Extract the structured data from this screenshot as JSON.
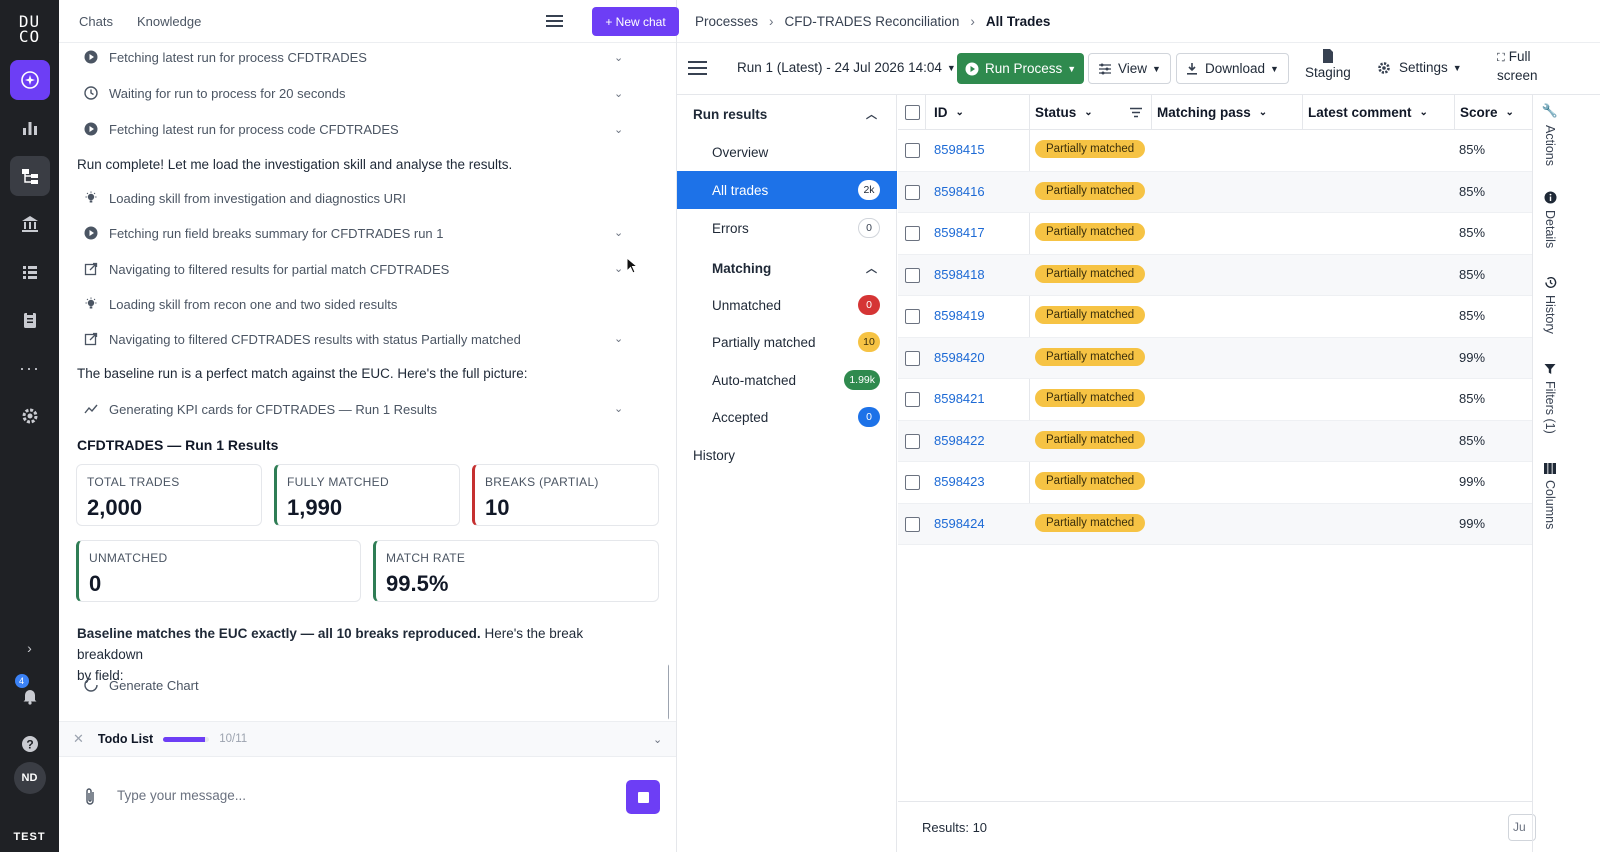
{
  "rail": {
    "logo_line1": "DU",
    "logo_line2": "CO",
    "notification_count": "4",
    "avatar_initials": "ND",
    "env_badge": "TEST"
  },
  "chat": {
    "tabs": [
      "Chats",
      "Knowledge"
    ],
    "new_chat_label": "+ New chat",
    "steps": [
      {
        "icon": "play-icon",
        "text": "Fetching latest run for process CFDTRADES",
        "expandable": true
      },
      {
        "icon": "clock-icon",
        "text": "Waiting for run to process for 20 seconds",
        "expandable": true
      },
      {
        "icon": "play-icon",
        "text": "Fetching latest run for process code CFDTRADES",
        "expandable": true
      }
    ],
    "msg1": "Run complete! Let me load the investigation skill and analyse the results.",
    "steps2": [
      {
        "icon": "bulb-icon",
        "text": "Loading skill from investigation and diagnostics URI",
        "expandable": false
      },
      {
        "icon": "play-icon",
        "text": "Fetching run field breaks summary for CFDTRADES run 1",
        "expandable": true
      },
      {
        "icon": "external-link-icon",
        "text": "Navigating to filtered results for partial match CFDTRADES",
        "expandable": true
      },
      {
        "icon": "bulb-icon",
        "text": "Loading skill from recon one and two sided results",
        "expandable": false
      },
      {
        "icon": "external-link-icon",
        "text": "Navigating to filtered CFDTRADES results with status Partially matched",
        "expandable": true
      }
    ],
    "msg2": "The baseline run is a perfect match against the EUC. Here's the full picture:",
    "kpi_step": "Generating KPI cards for CFDTRADES — Run 1 Results",
    "results_title": "CFDTRADES — Run 1 Results",
    "kpis": [
      {
        "label": "TOTAL TRADES",
        "value": "2,000"
      },
      {
        "label": "FULLY MATCHED",
        "value": "1,990"
      },
      {
        "label": "BREAKS (PARTIAL)",
        "value": "10"
      },
      {
        "label": "UNMATCHED",
        "value": "0"
      },
      {
        "label": "MATCH RATE",
        "value": "99.5%"
      }
    ],
    "summary_bold": "Baseline matches the EUC exactly — all 10 breaks reproduced.",
    "summary_rest": " Here's the break breakdown",
    "summary_line2": "by field:",
    "generate_chart": "Generate Chart",
    "todo_label": "Todo List",
    "todo_count": "10/11",
    "todo_progress": 0.909,
    "input_placeholder": "Type your message..."
  },
  "breadcrumb": [
    "Processes",
    "CFD-TRADES Reconciliation",
    "All Trades"
  ],
  "toolbar": {
    "run_selector": "Run 1 (Latest) - 24 Jul 2026 14:04",
    "run_process": "Run Process",
    "view": "View",
    "download": "Download",
    "staging": "Staging",
    "settings": "Settings",
    "full_line1": "Full",
    "full_line2": "screen"
  },
  "side_nav": {
    "run_results": "Run results",
    "overview": "Overview",
    "all_trades": "All trades",
    "all_trades_count": "2k",
    "errors": "Errors",
    "errors_count": "0",
    "matching": "Matching",
    "unmatched": "Unmatched",
    "unmatched_count": "0",
    "partially_matched": "Partially matched",
    "partially_matched_count": "10",
    "auto_matched": "Auto-matched",
    "auto_matched_count": "1.99k",
    "accepted": "Accepted",
    "accepted_count": "0",
    "history": "History"
  },
  "table": {
    "columns": [
      "ID",
      "Status",
      "Matching pass",
      "Latest comment",
      "Score"
    ],
    "rows": [
      {
        "id": "8598415",
        "status": "Partially matched",
        "score": "85%"
      },
      {
        "id": "8598416",
        "status": "Partially matched",
        "score": "85%"
      },
      {
        "id": "8598417",
        "status": "Partially matched",
        "score": "85%"
      },
      {
        "id": "8598418",
        "status": "Partially matched",
        "score": "85%"
      },
      {
        "id": "8598419",
        "status": "Partially matched",
        "score": "85%"
      },
      {
        "id": "8598420",
        "status": "Partially matched",
        "score": "99%"
      },
      {
        "id": "8598421",
        "status": "Partially matched",
        "score": "85%"
      },
      {
        "id": "8598422",
        "status": "Partially matched",
        "score": "85%"
      },
      {
        "id": "8598423",
        "status": "Partially matched",
        "score": "99%"
      },
      {
        "id": "8598424",
        "status": "Partially matched",
        "score": "99%"
      }
    ],
    "results_label": "Results: 10",
    "footer_box": "Ju"
  },
  "right_rail": [
    "Actions",
    "Details",
    "History",
    "Filters (1)",
    "Columns"
  ],
  "colors": {
    "brand_purple": "#6d3ef5",
    "active_blue": "#1d72e8",
    "run_green": "#2f8a4e",
    "partial_yellow": "#f6c344",
    "rail_dark": "#1f2125"
  }
}
